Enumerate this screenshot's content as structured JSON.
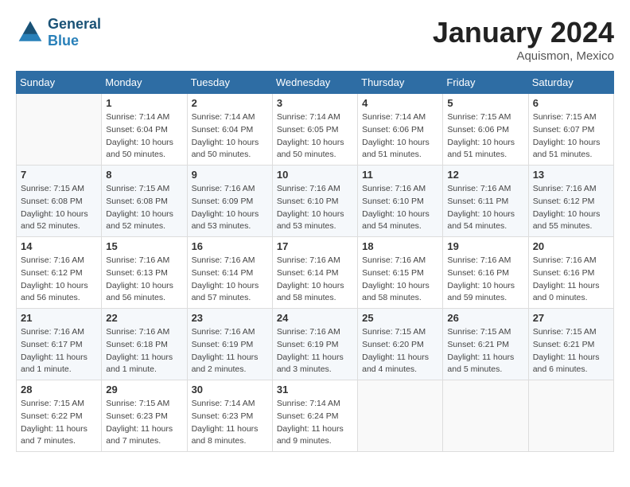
{
  "header": {
    "logo_line1": "General",
    "logo_line2": "Blue",
    "month": "January 2024",
    "location": "Aquismon, Mexico"
  },
  "weekdays": [
    "Sunday",
    "Monday",
    "Tuesday",
    "Wednesday",
    "Thursday",
    "Friday",
    "Saturday"
  ],
  "weeks": [
    [
      {
        "day": "",
        "empty": true
      },
      {
        "day": "1",
        "sunrise": "7:14 AM",
        "sunset": "6:04 PM",
        "daylight": "10 hours and 50 minutes."
      },
      {
        "day": "2",
        "sunrise": "7:14 AM",
        "sunset": "6:04 PM",
        "daylight": "10 hours and 50 minutes."
      },
      {
        "day": "3",
        "sunrise": "7:14 AM",
        "sunset": "6:05 PM",
        "daylight": "10 hours and 50 minutes."
      },
      {
        "day": "4",
        "sunrise": "7:14 AM",
        "sunset": "6:06 PM",
        "daylight": "10 hours and 51 minutes."
      },
      {
        "day": "5",
        "sunrise": "7:15 AM",
        "sunset": "6:06 PM",
        "daylight": "10 hours and 51 minutes."
      },
      {
        "day": "6",
        "sunrise": "7:15 AM",
        "sunset": "6:07 PM",
        "daylight": "10 hours and 51 minutes."
      }
    ],
    [
      {
        "day": "7",
        "sunrise": "7:15 AM",
        "sunset": "6:08 PM",
        "daylight": "10 hours and 52 minutes."
      },
      {
        "day": "8",
        "sunrise": "7:15 AM",
        "sunset": "6:08 PM",
        "daylight": "10 hours and 52 minutes."
      },
      {
        "day": "9",
        "sunrise": "7:16 AM",
        "sunset": "6:09 PM",
        "daylight": "10 hours and 53 minutes."
      },
      {
        "day": "10",
        "sunrise": "7:16 AM",
        "sunset": "6:10 PM",
        "daylight": "10 hours and 53 minutes."
      },
      {
        "day": "11",
        "sunrise": "7:16 AM",
        "sunset": "6:10 PM",
        "daylight": "10 hours and 54 minutes."
      },
      {
        "day": "12",
        "sunrise": "7:16 AM",
        "sunset": "6:11 PM",
        "daylight": "10 hours and 54 minutes."
      },
      {
        "day": "13",
        "sunrise": "7:16 AM",
        "sunset": "6:12 PM",
        "daylight": "10 hours and 55 minutes."
      }
    ],
    [
      {
        "day": "14",
        "sunrise": "7:16 AM",
        "sunset": "6:12 PM",
        "daylight": "10 hours and 56 minutes."
      },
      {
        "day": "15",
        "sunrise": "7:16 AM",
        "sunset": "6:13 PM",
        "daylight": "10 hours and 56 minutes."
      },
      {
        "day": "16",
        "sunrise": "7:16 AM",
        "sunset": "6:14 PM",
        "daylight": "10 hours and 57 minutes."
      },
      {
        "day": "17",
        "sunrise": "7:16 AM",
        "sunset": "6:14 PM",
        "daylight": "10 hours and 58 minutes."
      },
      {
        "day": "18",
        "sunrise": "7:16 AM",
        "sunset": "6:15 PM",
        "daylight": "10 hours and 58 minutes."
      },
      {
        "day": "19",
        "sunrise": "7:16 AM",
        "sunset": "6:16 PM",
        "daylight": "10 hours and 59 minutes."
      },
      {
        "day": "20",
        "sunrise": "7:16 AM",
        "sunset": "6:16 PM",
        "daylight": "11 hours and 0 minutes."
      }
    ],
    [
      {
        "day": "21",
        "sunrise": "7:16 AM",
        "sunset": "6:17 PM",
        "daylight": "11 hours and 1 minute."
      },
      {
        "day": "22",
        "sunrise": "7:16 AM",
        "sunset": "6:18 PM",
        "daylight": "11 hours and 1 minute."
      },
      {
        "day": "23",
        "sunrise": "7:16 AM",
        "sunset": "6:19 PM",
        "daylight": "11 hours and 2 minutes."
      },
      {
        "day": "24",
        "sunrise": "7:16 AM",
        "sunset": "6:19 PM",
        "daylight": "11 hours and 3 minutes."
      },
      {
        "day": "25",
        "sunrise": "7:15 AM",
        "sunset": "6:20 PM",
        "daylight": "11 hours and 4 minutes."
      },
      {
        "day": "26",
        "sunrise": "7:15 AM",
        "sunset": "6:21 PM",
        "daylight": "11 hours and 5 minutes."
      },
      {
        "day": "27",
        "sunrise": "7:15 AM",
        "sunset": "6:21 PM",
        "daylight": "11 hours and 6 minutes."
      }
    ],
    [
      {
        "day": "28",
        "sunrise": "7:15 AM",
        "sunset": "6:22 PM",
        "daylight": "11 hours and 7 minutes."
      },
      {
        "day": "29",
        "sunrise": "7:15 AM",
        "sunset": "6:23 PM",
        "daylight": "11 hours and 7 minutes."
      },
      {
        "day": "30",
        "sunrise": "7:14 AM",
        "sunset": "6:23 PM",
        "daylight": "11 hours and 8 minutes."
      },
      {
        "day": "31",
        "sunrise": "7:14 AM",
        "sunset": "6:24 PM",
        "daylight": "11 hours and 9 minutes."
      },
      {
        "day": "",
        "empty": true
      },
      {
        "day": "",
        "empty": true
      },
      {
        "day": "",
        "empty": true
      }
    ]
  ]
}
